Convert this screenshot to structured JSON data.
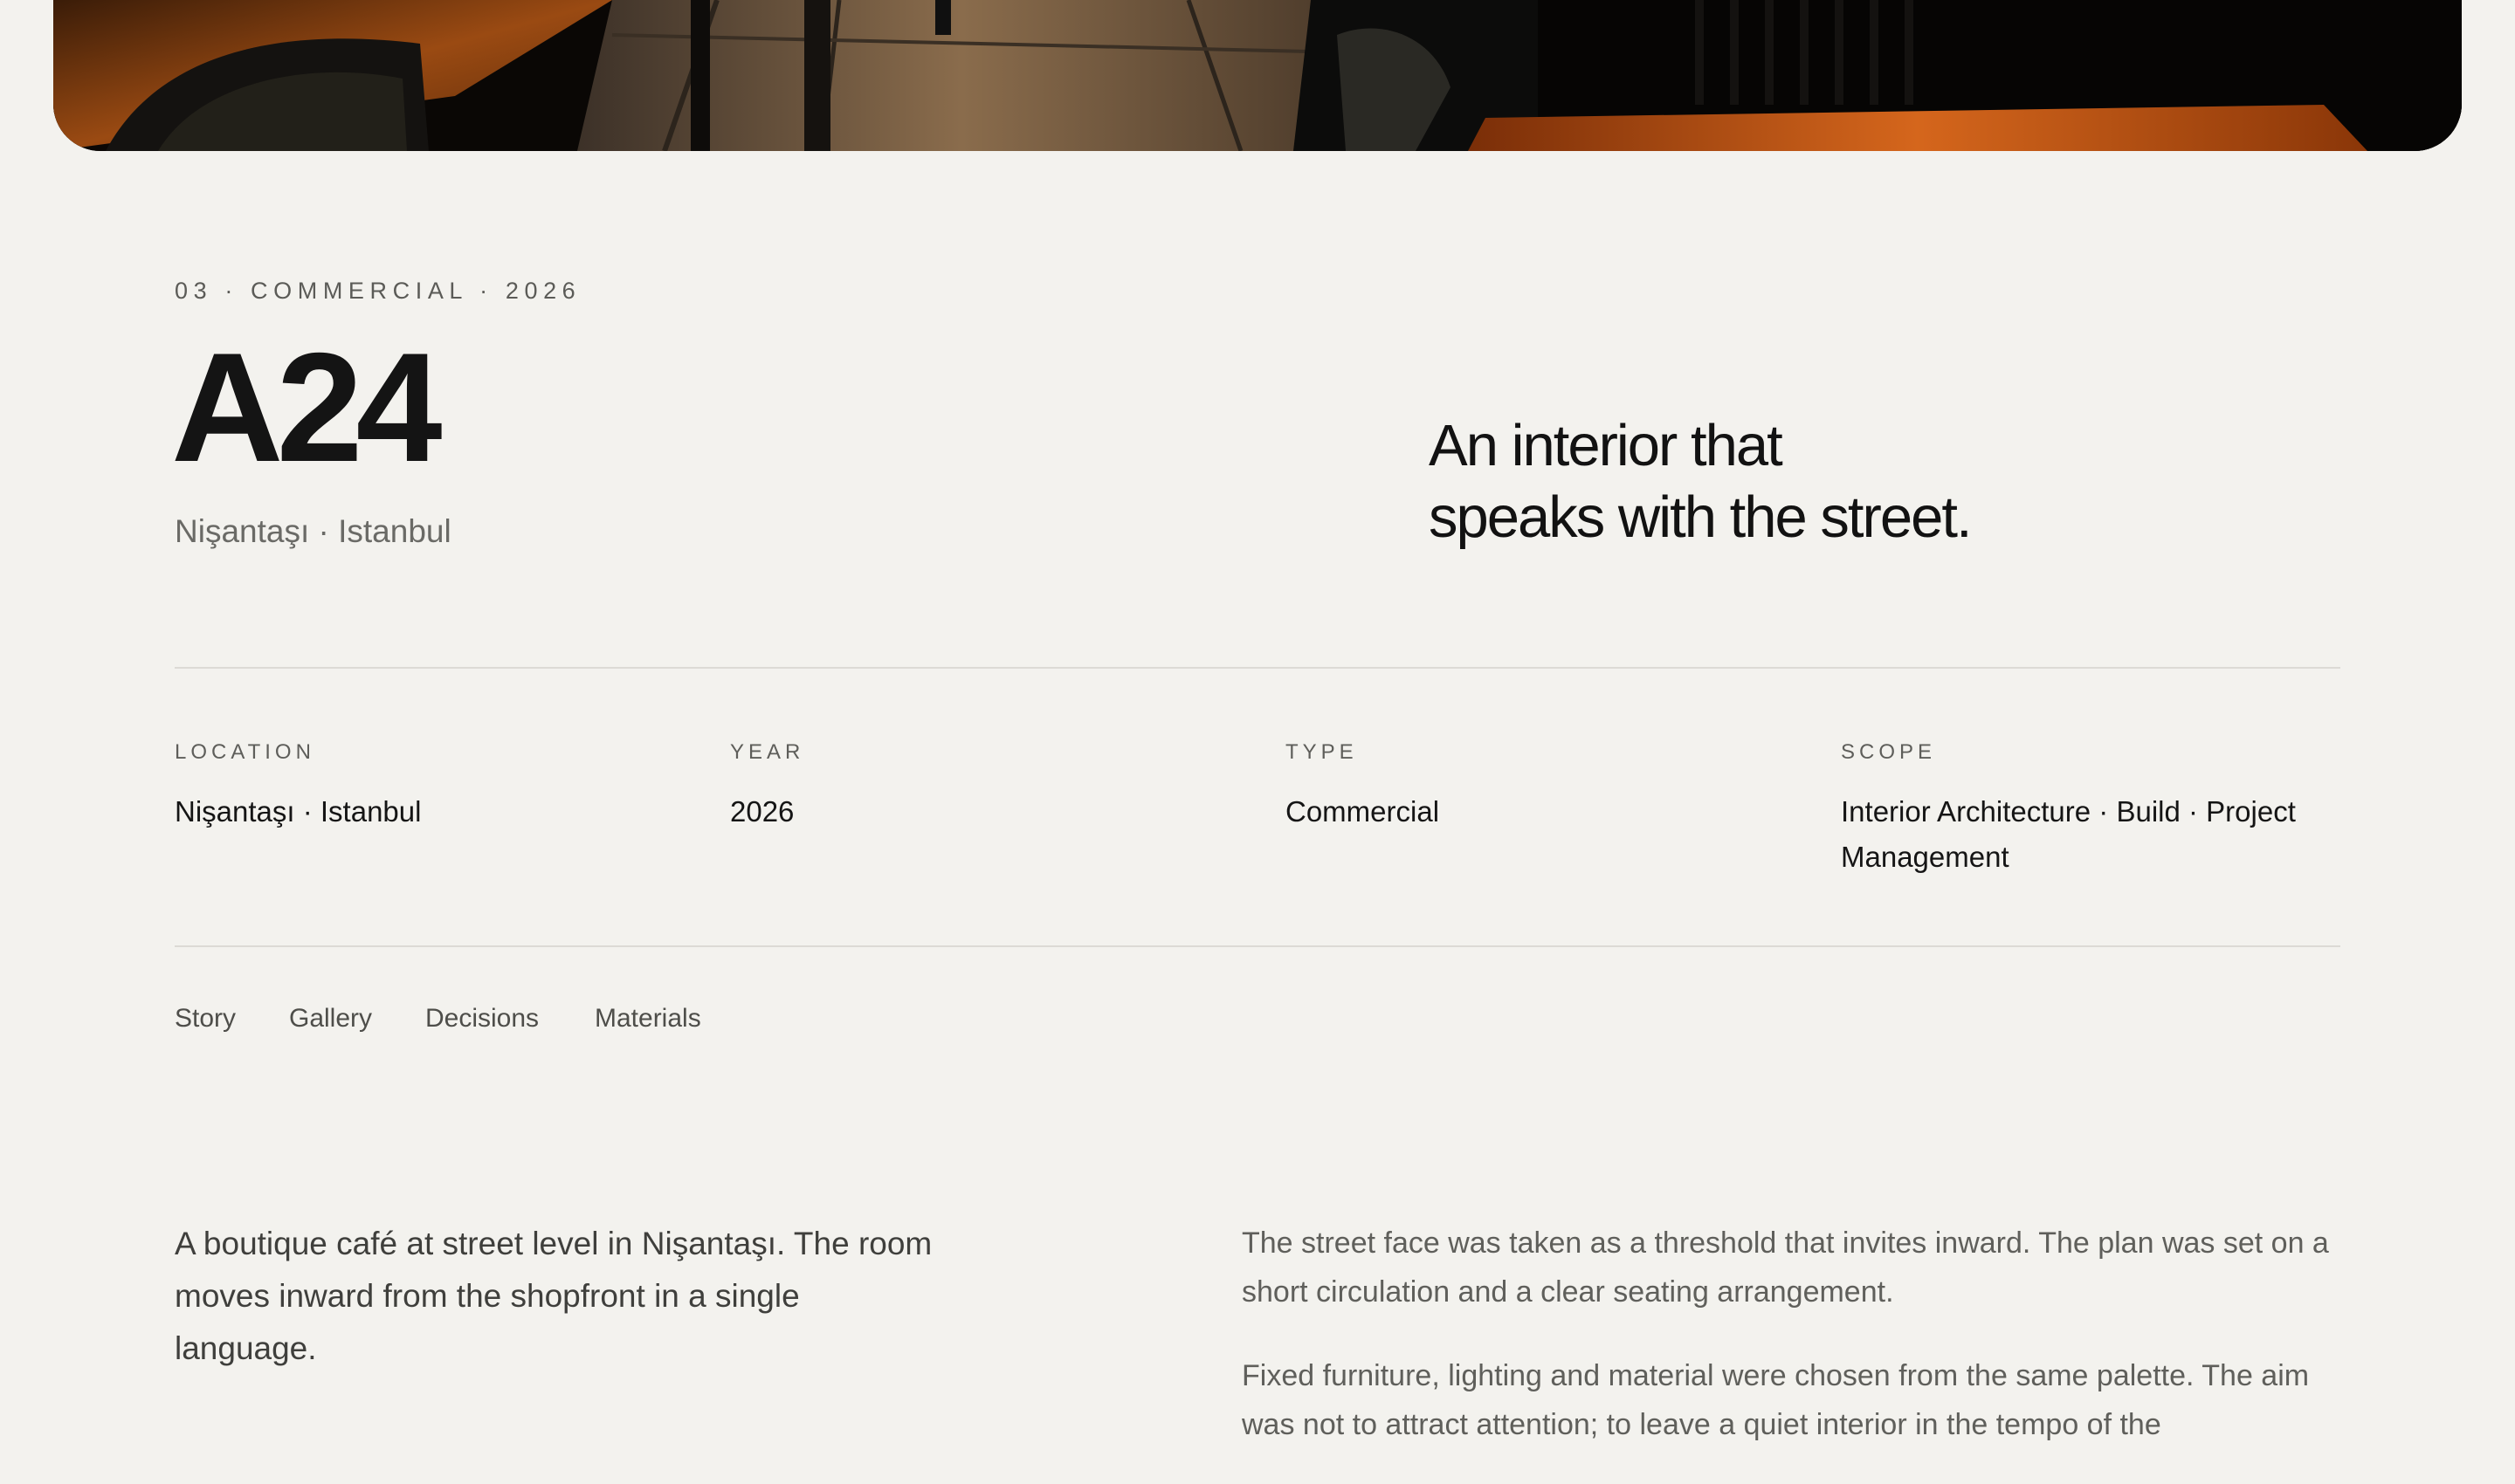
{
  "hero": {
    "image_description_icon": "cafe-interior-photo"
  },
  "header": {
    "eyebrow": "03 · COMMERCIAL · 2026",
    "title": "A24",
    "location": "Nişantaşı · Istanbul",
    "tagline_line1": "An interior that",
    "tagline_line2": "speaks with the street."
  },
  "facts": [
    {
      "label": "LOCATION",
      "value": "Nişantaşı · Istanbul"
    },
    {
      "label": "YEAR",
      "value": "2026"
    },
    {
      "label": "TYPE",
      "value": "Commercial"
    },
    {
      "label": "SCOPE",
      "value_line1": "Interior Architecture · Build · Project",
      "value_line2": "Management"
    }
  ],
  "tabs": [
    "Story",
    "Gallery",
    "Decisions",
    "Materials"
  ],
  "story": {
    "lead": "A boutique café at street level in Nişantaşı. The room moves inward from the shopfront in a single language.",
    "paragraph1": "The street face was taken as a threshold that invites inward. The plan was set on a short circulation and a clear seating arrangement.",
    "paragraph2": "Fixed furniture, lighting and material were chosen from the same palette. The aim was not to attract attention; to leave a quiet interior in the tempo of the"
  },
  "colors": {
    "background": "#f3f2ee",
    "text": "#111111",
    "muted": "#6a6a66",
    "rule": "#dcdad5"
  }
}
